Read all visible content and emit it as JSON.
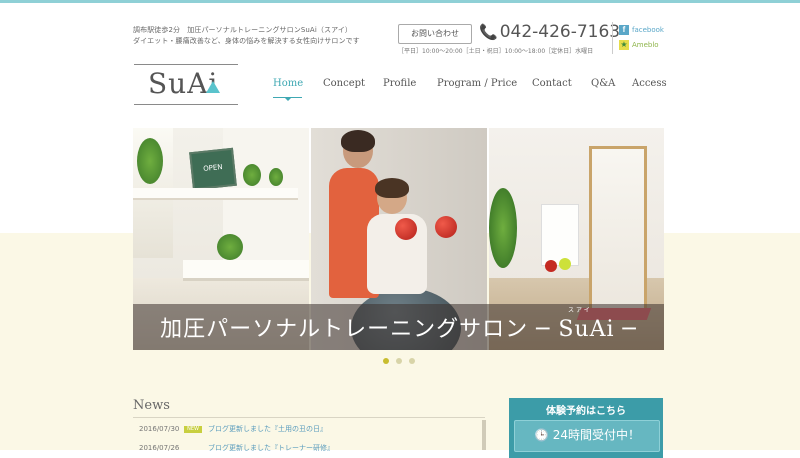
{
  "header": {
    "tagline_line1": "調布駅徒歩2分　加圧パーソナルトレーニングサロンSuAi（スアイ）",
    "tagline_line2": "ダイエット・腰痛改善など、身体の悩みを解決する女性向けサロンです",
    "logo_text": "SuAi",
    "contact_button": "お問い合わせ",
    "phone": "042-426-7163",
    "hours": "［平日］10:00～20:00［土日・祝日］10:00～18:00［定休日］水曜日",
    "social_facebook": "facebook",
    "social_ameblo": "Ameblo"
  },
  "nav": {
    "items": [
      "Home",
      "Concept",
      "Profile",
      "Program / Price",
      "Contact",
      "Q&A",
      "Access"
    ],
    "active_index": 0
  },
  "hero": {
    "title": "加圧パーソナルトレーニングサロン ─ SuAi ─",
    "ruby": "スアイ",
    "sign_text": "OPEN",
    "slides_total": 3,
    "active_slide": 0
  },
  "news": {
    "heading": "News",
    "items": [
      {
        "date": "2016/07/30",
        "badge": "NEW",
        "text": "ブログ更新しました『土用の丑の日』"
      },
      {
        "date": "2016/07/26",
        "badge": "",
        "text": "ブログ更新しました『トレーナー研修』"
      }
    ]
  },
  "booking": {
    "title": "体験予約はこちら",
    "button_text": "24時間受付中！"
  },
  "colors": {
    "accent": "#3fa8b3",
    "booking_bg": "#3c9ca8",
    "cream": "#fbf8e6",
    "badge": "#c8cf3f"
  }
}
